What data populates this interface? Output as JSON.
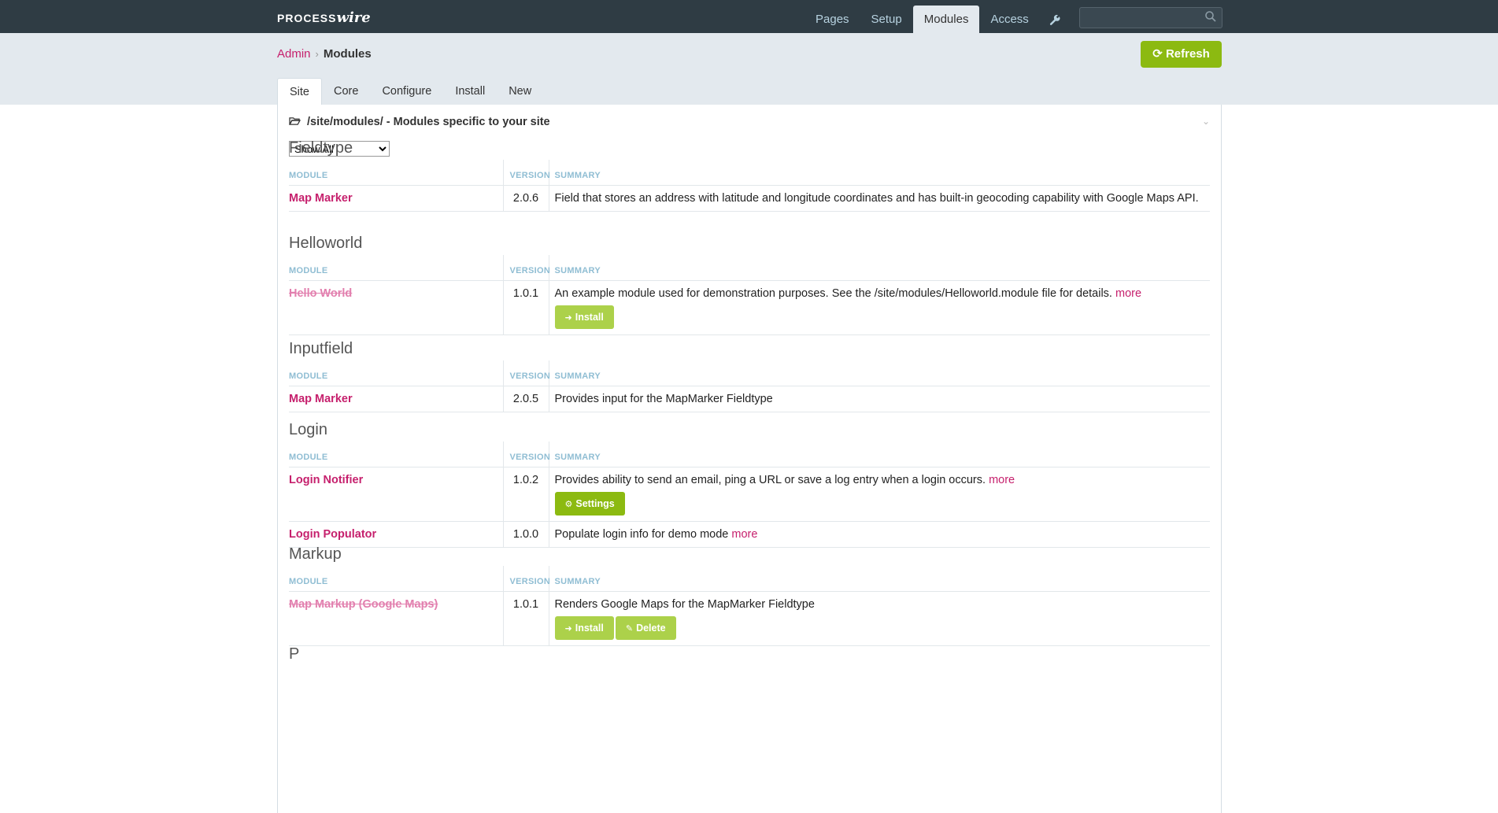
{
  "logo": {
    "part1": "PROCESS",
    "part2": "wire"
  },
  "nav": {
    "items": [
      "Pages",
      "Setup",
      "Modules",
      "Access"
    ],
    "active": "Modules"
  },
  "search": {
    "value": ""
  },
  "breadcrumb": {
    "root": "Admin",
    "current": "Modules"
  },
  "refresh_label": "Refresh",
  "tabs": [
    "Site",
    "Core",
    "Configure",
    "Install",
    "New"
  ],
  "panel": {
    "heading": "/site/modules/ - Modules specific to your site",
    "filter_selected": "Show All"
  },
  "columns": {
    "module": "MODULE",
    "version": "VERSION",
    "summary": "SUMMARY"
  },
  "groups": [
    {
      "title": "Fieldtype",
      "rows": [
        {
          "name": "Map Marker",
          "installed": true,
          "version": "2.0.6",
          "summary": "Field that stores an address with latitude and longitude coordinates and has built-in geocoding capability with Google Maps API.",
          "more": "",
          "buttons": []
        }
      ]
    },
    {
      "title": "Helloworld",
      "rows": [
        {
          "name": "Hello World",
          "installed": false,
          "version": "1.0.1",
          "summary": "An example module used for demonstration purposes. See the /site/modules/Helloworld.module file for details.",
          "more": "more",
          "buttons": [
            "Install"
          ]
        }
      ]
    },
    {
      "title": "Inputfield",
      "rows": [
        {
          "name": "Map Marker",
          "installed": true,
          "version": "2.0.5",
          "summary": "Provides input for the MapMarker Fieldtype",
          "more": "",
          "buttons": []
        }
      ]
    },
    {
      "title": "Login",
      "rows": [
        {
          "name": "Login Notifier",
          "installed": true,
          "version": "1.0.2",
          "summary": "Provides ability to send an email, ping a URL or save a log entry when a login occurs.",
          "more": "more",
          "buttons": [
            "Settings"
          ]
        },
        {
          "name": "Login Populator",
          "installed": true,
          "version": "1.0.0",
          "summary": "Populate login info for demo mode",
          "more": "more",
          "buttons": []
        }
      ]
    },
    {
      "title": "Markup",
      "rows": [
        {
          "name": "Map Markup (Google Maps)",
          "installed": false,
          "version": "1.0.1",
          "summary": "Renders Google Maps for the MapMarker Fieldtype",
          "more": "",
          "buttons": [
            "Install",
            "Delete"
          ]
        }
      ]
    },
    {
      "title": "P",
      "rows": []
    }
  ],
  "colors": {
    "topbar": "#2f3c44",
    "accent": "#c6206d",
    "button_green": "#8cba11",
    "button_light_green": "#acd14a",
    "header_band": "#e3e9ee"
  },
  "icons": {
    "wrench": "wrench-icon",
    "search": "search-icon",
    "folder": "folder-open-icon",
    "refresh": "refresh-icon",
    "install": "sign-in-icon",
    "settings": "gear-icon",
    "delete": "eraser-icon"
  }
}
